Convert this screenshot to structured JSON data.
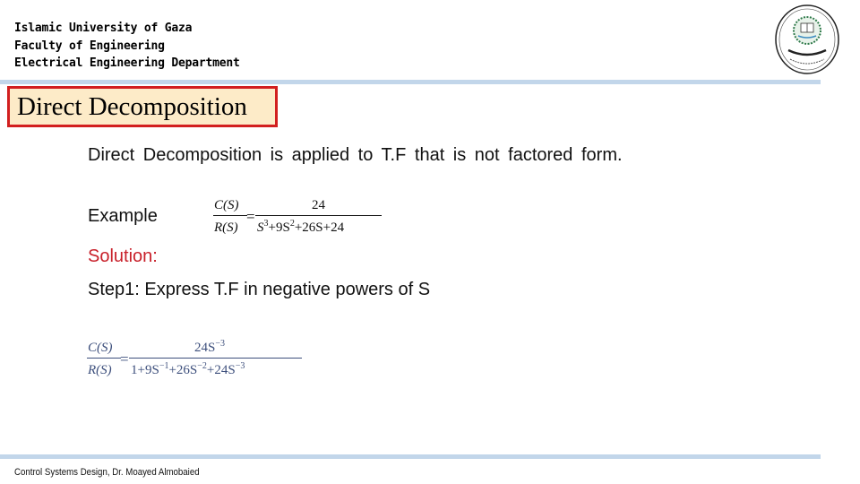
{
  "header": {
    "lines": [
      "Islamic University of Gaza",
      "Faculty of Engineering",
      "Electrical Engineering Department"
    ],
    "logo_icon": "university-seal-logo"
  },
  "slide": {
    "title": "Direct Decomposition",
    "paragraph": "Direct Decomposition is applied to T.F that is not factored form.",
    "example_label": "Example",
    "example_equation": {
      "lhs_num": "C(S)",
      "lhs_den": "R(S)",
      "equals": "=",
      "rhs_num": "24",
      "rhs_den_parts": [
        "S",
        "3",
        "+9S",
        "2",
        "+26S+24"
      ]
    },
    "solution_label": "Solution:",
    "step1": "Step1: Express T.F in negative powers of S",
    "step1_equation": {
      "lhs_num": "C(S)",
      "lhs_den": "R(S)",
      "equals": "=",
      "rhs_num_parts": [
        "24S",
        "−3"
      ],
      "rhs_den_parts": [
        "1+9S",
        "−1",
        "+26S",
        "−2",
        "+24S",
        "−3"
      ]
    }
  },
  "footer": {
    "text": "Control Systems Design, Dr. Moayed Almobaied"
  },
  "colors": {
    "title_border": "#d21f1f",
    "title_fill": "#fdebc8",
    "rule": "#c2d6ea",
    "solution": "#c8202a",
    "equation_blue": "#3d4f7c"
  }
}
